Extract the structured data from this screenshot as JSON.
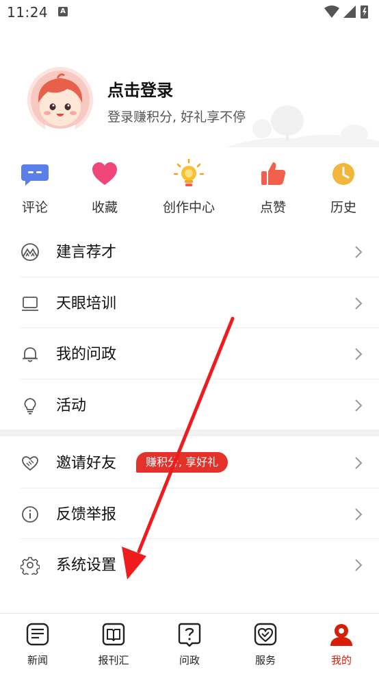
{
  "status_bar": {
    "time": "11:24",
    "notification_glyph": "A"
  },
  "profile": {
    "title": "点击登录",
    "subtitle": "登录赚积分, 好礼享不停",
    "avatar_icon": "avatar-icon"
  },
  "shortcuts": [
    {
      "label": "评论",
      "icon": "comment-icon",
      "color": "#5b7fe8"
    },
    {
      "label": "收藏",
      "icon": "heart-icon",
      "color": "#f0467a"
    },
    {
      "label": "创作中心",
      "icon": "lightbulb-icon",
      "color": "#f7a21b"
    },
    {
      "label": "点赞",
      "icon": "thumbs-up-icon",
      "color": "#f0604a"
    },
    {
      "label": "历史",
      "icon": "clock-icon",
      "color": "#f2b63c"
    }
  ],
  "menu": {
    "group1": [
      {
        "label": "建言荐才",
        "icon": "mountain-icon"
      },
      {
        "label": "天眼培训",
        "icon": "monitor-icon"
      },
      {
        "label": "我的问政",
        "icon": "bell-icon"
      },
      {
        "label": "活动",
        "icon": "lightbulb-outline-icon"
      }
    ],
    "group2": [
      {
        "label": "邀请好友",
        "icon": "handshake-icon",
        "badge": "赚积分, 享好礼"
      },
      {
        "label": "反馈举报",
        "icon": "info-icon"
      },
      {
        "label": "系统设置",
        "icon": "gear-icon"
      }
    ]
  },
  "bottom_nav": [
    {
      "label": "新闻",
      "icon": "news-icon",
      "active": false
    },
    {
      "label": "报刊汇",
      "icon": "book-icon",
      "active": false
    },
    {
      "label": "问政",
      "icon": "question-icon",
      "active": false
    },
    {
      "label": "服务",
      "icon": "heart-hands-icon",
      "active": false
    },
    {
      "label": "我的",
      "icon": "user-icon",
      "active": true
    }
  ],
  "colors": {
    "accent": "#d81e06",
    "badge": "#e4322b",
    "arrow": "#ee1c1c"
  }
}
